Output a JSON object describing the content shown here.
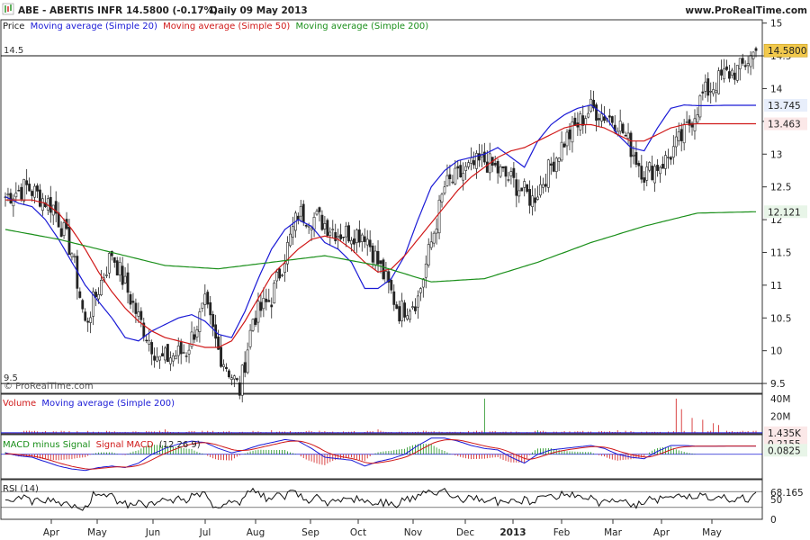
{
  "header": {
    "symbol": "ABE - ABERTIS INFR",
    "last": "14.5800 (-0.17%)",
    "timeframe": "Daily  09 May 2013",
    "site": "www.ProRealTime.com",
    "watermark": "© ProRealTime.com"
  },
  "legends": {
    "price_prefix": "Price",
    "ma20": "Moving average (Simple 20)",
    "ma50": "Moving average (Simple 50)",
    "ma200": "Moving average (Simple 200)",
    "volume_prefix": "Volume",
    "volume_ma": "Moving average (Simple 200)",
    "macd_a": "MACD minus Signal",
    "macd_b": "Signal MACD",
    "macd_params": "(12 26 9)",
    "rsi": "RSI (14)"
  },
  "colors": {
    "ma20": "#1a1ad6",
    "ma50": "#d01818",
    "ma200": "#1a8f1a",
    "volume": "#d01818",
    "volume_ma": "#1a1ad6",
    "price_tag_bg": "#f2c94c",
    "blue_tag_bg": "#e8eefb",
    "red_tag_bg": "#fbe8e8",
    "green_tag_bg": "#e8f5e8"
  },
  "chart_data": {
    "type": "line",
    "ohlc_style": "candlestick",
    "y_ticks": [
      "15",
      "14.5",
      "14",
      "13.5",
      "13",
      "12.5",
      "12",
      "11.5",
      "11",
      "10.5",
      "10",
      "9.5"
    ],
    "ylim": [
      9.35,
      15.05
    ],
    "hlines": [
      {
        "y": 14.5,
        "label": "14.5"
      },
      {
        "y": 9.5,
        "label": "9.5"
      }
    ],
    "x_ticks": [
      "Apr",
      "May",
      "Jun",
      "Jul",
      "Aug",
      "Sep",
      "Oct",
      "Nov",
      "Dec",
      "2013",
      "Feb",
      "Mar",
      "Apr",
      "May"
    ],
    "bold_tick": "2013",
    "series": [
      {
        "name": "Moving average (Simple 20)",
        "x": [
          0,
          5,
          10,
          15,
          20,
          25,
          30,
          35,
          40,
          45,
          50,
          55,
          60,
          65,
          70,
          75,
          80,
          85,
          90,
          95,
          100,
          105,
          110,
          115,
          120,
          125,
          130,
          135,
          140,
          145,
          150,
          155,
          160,
          165,
          170,
          175,
          180,
          185,
          190,
          195,
          200,
          205,
          210,
          215,
          220,
          225,
          230,
          235,
          240,
          245,
          250,
          255,
          260,
          265,
          270,
          275,
          280,
          282
        ],
        "values": [
          12.35,
          12.25,
          12.2,
          12.0,
          11.7,
          11.35,
          11.0,
          10.75,
          10.5,
          10.2,
          10.15,
          10.3,
          10.4,
          10.5,
          10.55,
          10.45,
          10.25,
          10.2,
          10.6,
          11.1,
          11.55,
          11.85,
          12.0,
          11.9,
          11.65,
          11.55,
          11.35,
          10.95,
          10.95,
          11.1,
          11.45,
          12.0,
          12.5,
          12.75,
          12.9,
          12.95,
          13.0,
          13.1,
          12.95,
          12.8,
          13.2,
          13.45,
          13.6,
          13.7,
          13.75,
          13.6,
          13.3,
          13.1,
          13.05,
          13.4,
          13.7,
          13.75,
          13.74,
          13.74,
          13.745,
          13.745,
          13.745,
          13.745
        ]
      },
      {
        "name": "Moving average (Simple 50)",
        "x": [
          0,
          5,
          10,
          15,
          20,
          25,
          30,
          35,
          40,
          45,
          50,
          55,
          60,
          65,
          70,
          75,
          80,
          85,
          90,
          95,
          100,
          105,
          110,
          115,
          120,
          125,
          130,
          135,
          140,
          145,
          150,
          155,
          160,
          165,
          170,
          175,
          180,
          185,
          190,
          195,
          200,
          205,
          210,
          215,
          220,
          225,
          230,
          235,
          240,
          245,
          250,
          255,
          260,
          265,
          270,
          275,
          280,
          282
        ],
        "values": [
          12.3,
          12.3,
          12.3,
          12.25,
          12.1,
          11.85,
          11.55,
          11.2,
          10.9,
          10.65,
          10.45,
          10.3,
          10.2,
          10.15,
          10.1,
          10.05,
          10.05,
          10.15,
          10.45,
          10.8,
          11.15,
          11.35,
          11.55,
          11.7,
          11.75,
          11.7,
          11.55,
          11.35,
          11.2,
          11.25,
          11.45,
          11.7,
          11.95,
          12.2,
          12.45,
          12.65,
          12.8,
          12.95,
          13.05,
          13.1,
          13.2,
          13.3,
          13.4,
          13.45,
          13.45,
          13.4,
          13.3,
          13.2,
          13.2,
          13.3,
          13.4,
          13.45,
          13.463,
          13.463,
          13.463,
          13.463,
          13.463,
          13.463
        ]
      },
      {
        "name": "Moving average (Simple 200)",
        "x": [
          0,
          20,
          40,
          60,
          80,
          100,
          120,
          140,
          160,
          180,
          200,
          220,
          240,
          260,
          282
        ],
        "values": [
          11.85,
          11.7,
          11.5,
          11.3,
          11.25,
          11.35,
          11.45,
          11.3,
          11.05,
          11.1,
          11.35,
          11.65,
          11.9,
          12.1,
          12.121
        ]
      }
    ],
    "markers": [
      {
        "label": "14.5800",
        "y": 14.58
      },
      {
        "label": "13.745",
        "y": 13.745
      },
      {
        "label": "13.463",
        "y": 13.463
      },
      {
        "label": "12.121",
        "y": 12.121
      }
    ],
    "volume": {
      "ticks": [
        "40M",
        "20M"
      ],
      "ylim": [
        0,
        45
      ],
      "ma_label": "1.435K"
    },
    "macd": {
      "ticks": [
        "0.2155",
        "0.0825"
      ],
      "ylim": [
        -0.5,
        0.4
      ]
    },
    "rsi": {
      "ticks": [
        "68.165",
        "50",
        "0"
      ],
      "ylim": [
        0,
        100
      ]
    }
  }
}
